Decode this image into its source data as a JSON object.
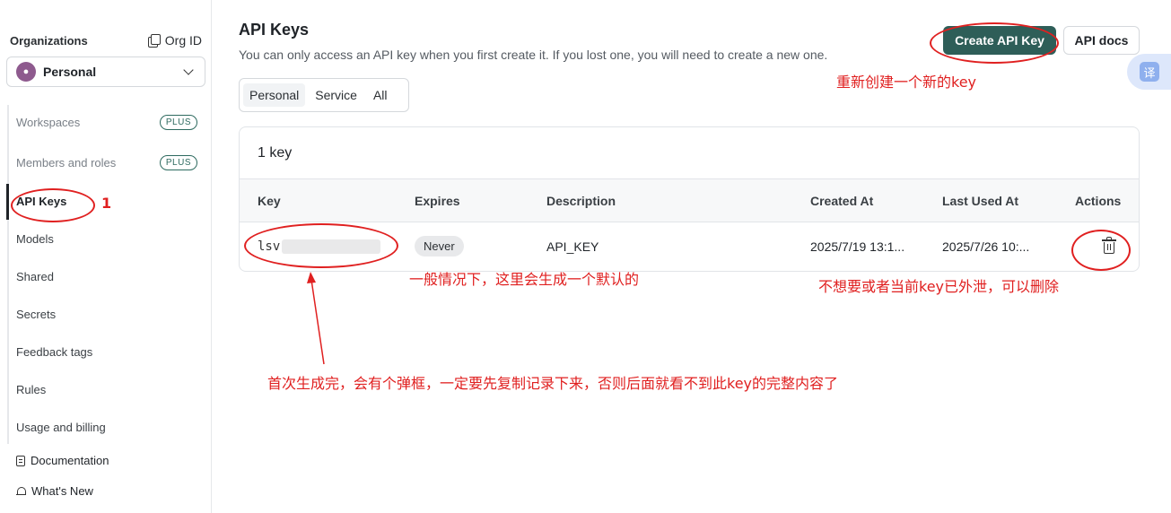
{
  "sidebar": {
    "org_title": "Organizations",
    "org_id_label": "Org ID",
    "org_select": {
      "avatar": "user-icon",
      "value": "Personal"
    },
    "items": [
      {
        "label": "Workspaces",
        "badge": "PLUS"
      },
      {
        "label": "Members and roles",
        "badge": "PLUS"
      },
      {
        "label": "API Keys"
      },
      {
        "label": "Models"
      },
      {
        "label": "Shared"
      },
      {
        "label": "Secrets"
      },
      {
        "label": "Feedback tags"
      },
      {
        "label": "Rules"
      },
      {
        "label": "Usage and billing"
      }
    ],
    "footer": [
      {
        "label": "Documentation",
        "icon": "document-icon"
      },
      {
        "label": "What's New",
        "icon": "bell-icon"
      }
    ]
  },
  "main": {
    "title": "API Keys",
    "subtitle": "You can only access an API key when you first create it. If you lost one, you will need to create a new one.",
    "create_button": "Create API Key",
    "docs_button": "API docs",
    "translate_glyph": "译",
    "tabs": [
      "Personal",
      "Service",
      "All"
    ],
    "count": "1 key",
    "columns": [
      "Key",
      "Expires",
      "Description",
      "Created At",
      "Last Used At",
      "Actions"
    ],
    "rows": [
      {
        "key_prefix": "lsv",
        "expires": "Never",
        "description": "API_KEY",
        "created_at": "2025/7/19 13:1...",
        "last_used_at": "2025/7/26 10:..."
      }
    ]
  },
  "annotations": {
    "color": "#e02020",
    "step": "1",
    "create_note": "重新创建一个新的key",
    "default_note": "一般情况下，这里会生成一个默认的",
    "delete_note": "不想要或者当前key已外泄，可以删除",
    "copy_note": "首次生成完，会有个弹框，一定要先复制记录下来，否则后面就看不到此key的完整内容了"
  }
}
